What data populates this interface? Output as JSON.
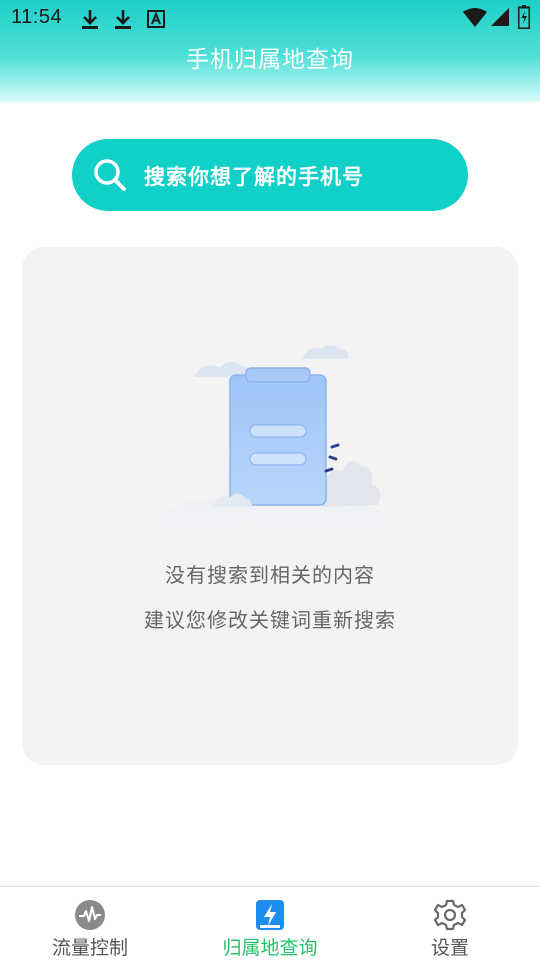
{
  "status_bar": {
    "time": "11:54",
    "left_icons": [
      "download-icon",
      "download-icon",
      "font-icon"
    ],
    "right_icons": [
      "wifi-icon",
      "signal-icon",
      "battery-icon"
    ]
  },
  "header": {
    "title": "手机归属地查询",
    "gradient_colors": [
      "#1ecfc6",
      "#d9fbf9"
    ]
  },
  "search": {
    "placeholder": "搜索你想了解的手机号",
    "icon": "search-icon",
    "background": "#11d0c8"
  },
  "empty_state": {
    "illustration": "clipboard-empty-illustration",
    "title": "没有搜索到相关的内容",
    "subtitle": "建议您修改关键词重新搜索"
  },
  "bottom_nav": {
    "active_color": "#22c36a",
    "items": [
      {
        "label": "流量控制",
        "icon": "pulse-icon",
        "active": false
      },
      {
        "label": "归属地查询",
        "icon": "bolt-icon",
        "active": true
      },
      {
        "label": "设置",
        "icon": "gear-icon",
        "active": false
      }
    ]
  }
}
